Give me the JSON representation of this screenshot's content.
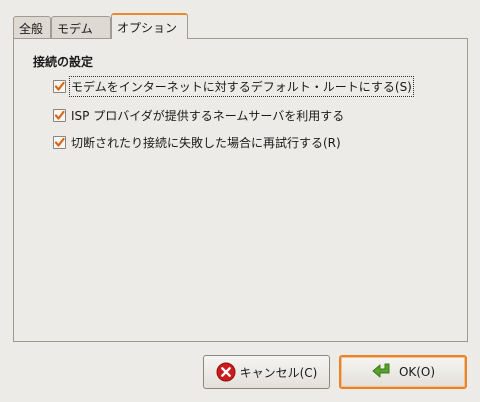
{
  "tabs": [
    {
      "label": "全般"
    },
    {
      "label": "モデム"
    },
    {
      "label": "オプション"
    }
  ],
  "section_title": "接続の設定",
  "options": [
    {
      "label": "モデムをインターネットに対するデフォルト・ルートにする(S)",
      "checked": true
    },
    {
      "label": "ISP プロバイダが提供するネームサーバを利用する",
      "checked": true
    },
    {
      "label": "切断されたり接続に失敗した場合に再試行する(R)",
      "checked": true
    }
  ],
  "buttons": {
    "cancel_label": "キャンセル(C)",
    "ok_label": "OK(O)"
  },
  "icons": {
    "cancel": "cancel-icon",
    "ok": "ok-arrow-icon",
    "check": "check-icon"
  },
  "colors": {
    "accent": "#e88b2a",
    "check": "#d2691e",
    "cancel_red": "#cc1b1b",
    "ok_green": "#5aa02c"
  }
}
